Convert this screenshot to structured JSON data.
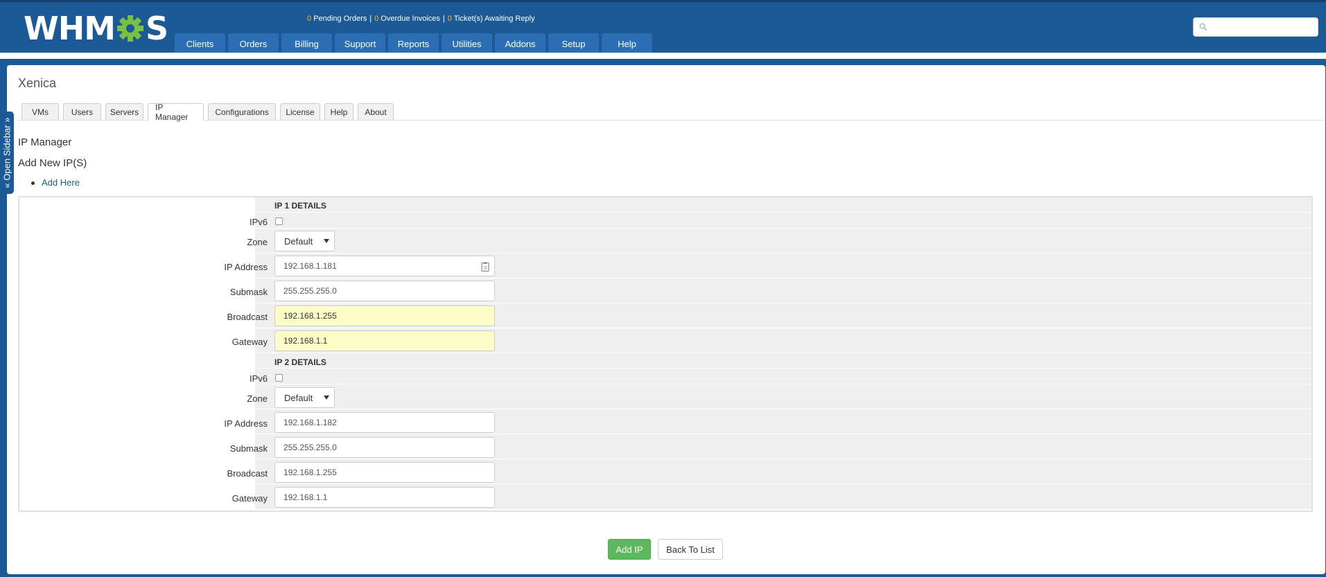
{
  "header": {
    "logo_text_left": "WHM",
    "logo_text_right": "S",
    "alerts": [
      {
        "count": "0",
        "label": "Pending Orders"
      },
      {
        "count": "0",
        "label": "Overdue Invoices"
      },
      {
        "count": "0",
        "label": "Ticket(s) Awaiting Reply"
      }
    ],
    "alert_separator": "|",
    "nav": [
      "Clients",
      "Orders",
      "Billing",
      "Support",
      "Reports",
      "Utilities",
      "Addons",
      "Setup",
      "Help"
    ],
    "search": {
      "value": "",
      "placeholder": ""
    }
  },
  "sidebar": {
    "label": "« Open Sidebar »"
  },
  "page": {
    "title": "Xenica",
    "tabs": [
      "VMs",
      "Users",
      "Servers",
      "IP Manager",
      "Configurations",
      "License",
      "Help",
      "About"
    ],
    "active_tab": "IP Manager",
    "section_title": "IP Manager",
    "subsection_title": "Add New IP(S)",
    "links": [
      "Add Here"
    ]
  },
  "ip_blocks": [
    {
      "heading": "IP 1 DETAILS",
      "ipv6_label": "IPv6",
      "zone_label": "Zone",
      "zone_value": "Default",
      "ip_label": "IP Address",
      "ip_value": "192.168.1.181",
      "submask_label": "Submask",
      "submask_value": "255.255.255.0",
      "broadcast_label": "Broadcast",
      "broadcast_value": "192.168.1.255",
      "gateway_label": "Gateway",
      "gateway_value": "192.168.1.1"
    },
    {
      "heading": "IP 2 DETAILS",
      "ipv6_label": "IPv6",
      "zone_label": "Zone",
      "zone_value": "Default",
      "ip_label": "IP Address",
      "ip_value": "192.168.1.182",
      "submask_label": "Submask",
      "submask_value": "255.255.255.0",
      "broadcast_label": "Broadcast",
      "broadcast_value": "192.168.1.255",
      "gateway_label": "Gateway",
      "gateway_value": "192.168.1.1"
    }
  ],
  "actions": {
    "add_label": "Add IP",
    "back_label": "Back To List"
  },
  "colors": {
    "header": "#1b5a96",
    "primary_button": "#5cb85c",
    "autofill_highlight": "#fbfcc6",
    "alert_count": "#f7b731"
  }
}
